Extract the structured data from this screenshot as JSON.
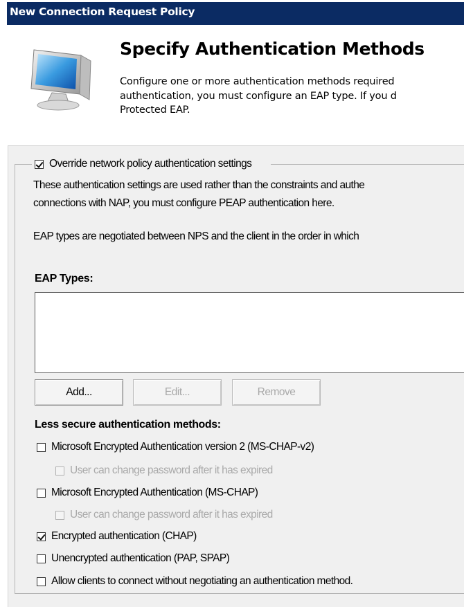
{
  "window": {
    "title": "New Connection Request Policy"
  },
  "header": {
    "heading": "Specify Authentication Methods",
    "description_lines": [
      "Configure one or more authentication methods required",
      "authentication, you must configure an EAP type. If you d",
      "Protected EAP."
    ]
  },
  "override": {
    "checked": true,
    "label": "Override network policy authentication settings"
  },
  "info_lines": [
    "These authentication settings are used rather than the constraints and authe",
    "connections with NAP, you must configure PEAP authentication here.",
    "EAP types are negotiated between NPS and the client in the order in which"
  ],
  "eap": {
    "label": "EAP Types:",
    "items": []
  },
  "buttons": {
    "add": "Add...",
    "edit": "Edit...",
    "remove": "Remove"
  },
  "less_secure": {
    "label": "Less secure authentication methods:",
    "options": [
      {
        "label": "Microsoft Encrypted Authentication version 2 (MS-CHAP-v2)",
        "checked": false,
        "disabled": false
      },
      {
        "label": "User can change password after it has expired",
        "checked": false,
        "disabled": true
      },
      {
        "label": "Microsoft Encrypted Authentication (MS-CHAP)",
        "checked": false,
        "disabled": false
      },
      {
        "label": "User can change password after it has expired",
        "checked": false,
        "disabled": true
      },
      {
        "label": "Encrypted authentication (CHAP)",
        "checked": true,
        "disabled": false
      },
      {
        "label": "Unencrypted authentication (PAP, SPAP)",
        "checked": false,
        "disabled": false
      },
      {
        "label": "Allow clients to connect without negotiating an authentication method.",
        "checked": false,
        "disabled": false
      }
    ]
  },
  "colors": {
    "titlebar": "#0b2b63",
    "panel": "#f0f0f0",
    "disabled_text": "#a9a9a9"
  },
  "icons": {
    "header": "computer-monitor-icon"
  }
}
